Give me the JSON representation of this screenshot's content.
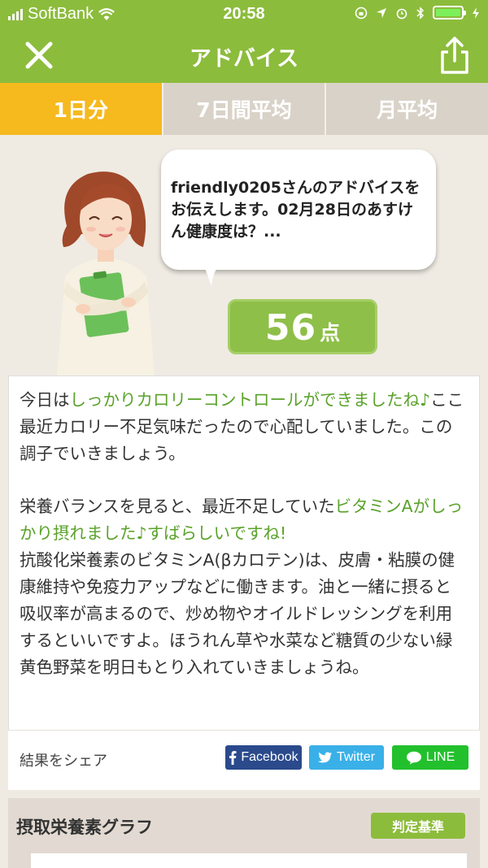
{
  "status_bar": {
    "carrier": "SoftBank",
    "time": "20:58"
  },
  "nav": {
    "title": "アドバイス"
  },
  "tabs": [
    {
      "label": "1日分",
      "active": true
    },
    {
      "label": "7日間平均",
      "active": false
    },
    {
      "label": "月平均",
      "active": false
    }
  ],
  "bubble": {
    "text": "friendly0205さんのアドバイスをお伝えします。02月28日のあすけん健康度は？..."
  },
  "score": {
    "value": "56",
    "unit": "点"
  },
  "advice": {
    "p1": [
      {
        "text": "今日は",
        "highlight": false
      },
      {
        "text": "しっかりカロリーコントロールができましたね♪",
        "highlight": true
      },
      {
        "text": "ここ最近カロリー不足気味だったので心配していました。この調子でいきましょう。",
        "highlight": false
      }
    ],
    "p2": [
      {
        "text": "栄養バランスを見ると、最近不足していた",
        "highlight": false
      },
      {
        "text": "ビタミンAがしっかり摂れました♪すばらしいですね!",
        "highlight": true
      }
    ],
    "p3": "抗酸化栄養素のビタミンA(βカロテン)は、皮膚・粘膜の健康維持や免疫力アップなどに働きます。油と一緒に摂ると吸収率が高まるので、炒め物やオイルドレッシングを利用するといいですよ。ほうれん草や水菜など糖質の少ない緑黄色野菜を明日もとり入れていきましょうね。"
  },
  "share": {
    "label": "結果をシェア",
    "facebook": "Facebook",
    "twitter": "Twitter",
    "line": "LINE"
  },
  "graph": {
    "title": "摂取栄養素グラフ",
    "criteria_button": "判定基準"
  },
  "colors": {
    "brand_green": "#8cbc3c",
    "tab_active": "#f6b91e",
    "highlight_green": "#5aa22a"
  }
}
